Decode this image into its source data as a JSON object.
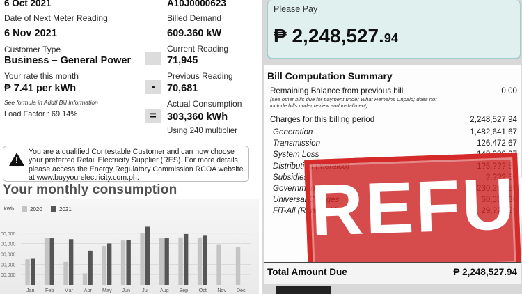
{
  "left": {
    "read_date_top": "6 Oct 2021",
    "next_reading_label": "Date of Next Meter Reading",
    "next_reading_value": "6 Nov 2021",
    "customer_type_label": "Customer Type",
    "customer_type_value": "Business – General Power",
    "rate_label": "Your rate this month",
    "rate_value": "₱ 7.41 per kWh",
    "rate_note": "See formula in Addtl Bill Information",
    "load_factor": "Load Factor : 69.14%",
    "account_no": "A10J0000623",
    "billed_demand_label": "Billed Demand",
    "billed_demand_value": "609.360 kW",
    "current_reading_label": "Current Reading",
    "current_reading_value": "71,945",
    "minus_sign": "-",
    "previous_reading_label": "Previous Reading",
    "previous_reading_value": "70,681",
    "equals_sign": "=",
    "actual_consumption_label": "Actual Consumption",
    "actual_consumption_value": "303,360 kWh",
    "multiplier_text": "Using 240 multiplier",
    "notice_text": "You are a qualified Contestable Customer and can now choose your preferred Retail Electricity Supplier (RES). For more details, please access the Energy Regulatory Commission RCOA website at www.buyyourelectricity.com.ph.",
    "warning_icon": "warning-triangle-icon"
  },
  "chart_data": {
    "type": "bar",
    "title": "Your monthly consumption",
    "unit_label": "kWh",
    "categories": [
      "Jan",
      "Feb",
      "Mar",
      "Apr",
      "May",
      "Jun",
      "Jul",
      "Aug",
      "Sep",
      "Oct",
      "Nov",
      "Dec"
    ],
    "series": [
      {
        "name": "2020",
        "color": "#c4c4c4",
        "values": [
          300000,
          550000,
          270000,
          135000,
          455000,
          520000,
          610000,
          550000,
          555000,
          555000,
          475000,
          445000
        ]
      },
      {
        "name": "2021",
        "color": "#555555",
        "values": [
          305000,
          545000,
          535000,
          400000,
          485000,
          525000,
          680000,
          545000,
          595000,
          575000,
          null,
          null
        ]
      }
    ],
    "ytick_labels": [
      "00,000",
      "00,000",
      "00,000",
      "00,000",
      "00,000"
    ],
    "ylim": [
      0,
      700000
    ]
  },
  "right": {
    "please_pay_label": "Please Pay",
    "amount_symbol": "₱",
    "amount_main": "2,248,527.",
    "amount_cents": "94",
    "summary_title": "Bill Computation Summary",
    "remaining_label": "Remaining Balance from previous bill",
    "remaining_value": "0.00",
    "remaining_note": "(see other bills due for payment under What Remains Unpaid; does not include bills under review and installment)",
    "charges_label": "Charges for this billing period",
    "charges_value": "2,248,527.94",
    "items": [
      {
        "label": "Generation",
        "value": "1,482,641.67"
      },
      {
        "label": "Transmission",
        "value": "126,472.67"
      },
      {
        "label": "System Loss",
        "value": "148,282.37"
      },
      {
        "label": "Distribution (Meralco)",
        "value": "1?5,???.59"
      },
      {
        "label": "Subsidies",
        "value": "?,???.60"
      },
      {
        "label": "Government Taxes",
        "value": "230,262.55"
      },
      {
        "label": "Universal Charges",
        "value": "60,338.30"
      },
      {
        "label": "FiT-All (Renewable)",
        "value": "29,?20.29"
      }
    ],
    "stamp_text": "REFUND",
    "total_label": "Total Amount Due",
    "total_value": "₱ 2,248,527.94"
  }
}
